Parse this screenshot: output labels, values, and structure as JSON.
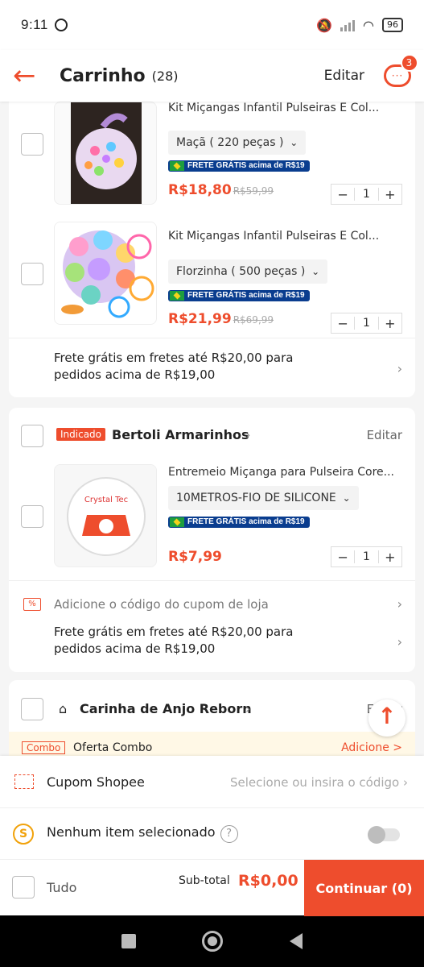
{
  "status": {
    "time": "9:11",
    "battery": "96"
  },
  "header": {
    "title": "Carrinho",
    "count": "(28)",
    "edit": "Editar",
    "chat_badge": "3"
  },
  "items": [
    {
      "title": "Kit Miçangas Infantil Pulseiras E Col...",
      "variant": "Maçã ( 220 peças )",
      "frete": "FRETE GRÁTIS acima de R$19",
      "price": "R$18,80",
      "old_price": "R$59,99",
      "qty": "1"
    },
    {
      "title": "Kit Miçangas Infantil Pulseiras E Col...",
      "variant": "Florzinha ( 500 peças )",
      "frete": "FRETE GRÁTIS acima de R$19",
      "price": "R$21,99",
      "old_price": "R$69,99",
      "qty": "1"
    },
    {
      "title": "Entremeio Miçanga para Pulseira Core...",
      "variant": "10METROS-FIO DE SILICONE",
      "frete": "FRETE GRÁTIS acima de R$19",
      "price": "R$7,99",
      "old_price": "",
      "qty": "1"
    }
  ],
  "shipping_note": "Frete grátis em fretes até R$20,00 para pedidos acima de R$19,00",
  "store2": {
    "tag": "Indicado",
    "name": "Bertoli Armarinhos",
    "edit": "Editar",
    "coupon": "Adicione o código do cupom de loja"
  },
  "store3": {
    "name": "Carinha de Anjo Reborn",
    "edit": "Editar"
  },
  "combo": {
    "tag": "Combo",
    "text": "Oferta Combo",
    "link": "Adicione >"
  },
  "bottom": {
    "coupon_label": "Cupom Shopee",
    "coupon_hint": "Selecione ou insira o código",
    "coins_label": "Nenhum item selecionado",
    "all_label": "Tudo",
    "subtotal_label": "Sub-total",
    "subtotal_value": "R$0,00",
    "continue": "Continuar (0)"
  }
}
